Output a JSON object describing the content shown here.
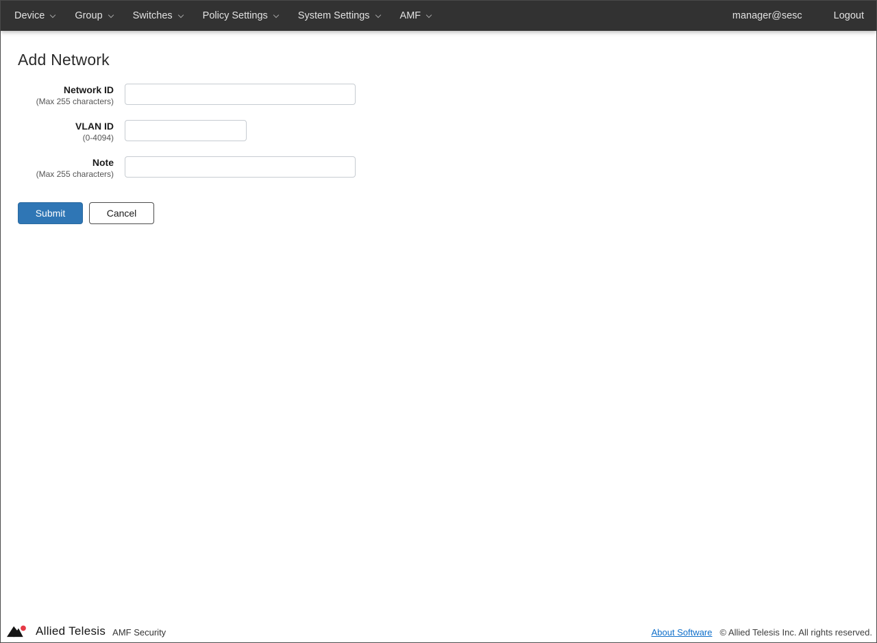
{
  "navbar": {
    "items": [
      {
        "label": "Device"
      },
      {
        "label": "Group"
      },
      {
        "label": "Switches"
      },
      {
        "label": "Policy Settings"
      },
      {
        "label": "System Settings"
      },
      {
        "label": "AMF"
      }
    ],
    "user": "manager@sesc",
    "logout_label": "Logout"
  },
  "page": {
    "title": "Add Network"
  },
  "form": {
    "fields": [
      {
        "label": "Network ID",
        "hint": "(Max 255 characters)",
        "value": ""
      },
      {
        "label": "VLAN ID",
        "hint": "(0-4094)",
        "value": ""
      },
      {
        "label": "Note",
        "hint": "(Max 255 characters)",
        "value": ""
      }
    ],
    "submit_label": "Submit",
    "cancel_label": "Cancel"
  },
  "footer": {
    "brand": "Allied Telesis",
    "product": "AMF Security",
    "about_link": "About Software",
    "copyright": "© Allied Telesis Inc. All rights reserved."
  },
  "colors": {
    "navbar_bg": "#323232",
    "accent_blue": "#2f76b5",
    "link_blue": "#0d6eca",
    "logo_red": "#e63946"
  }
}
